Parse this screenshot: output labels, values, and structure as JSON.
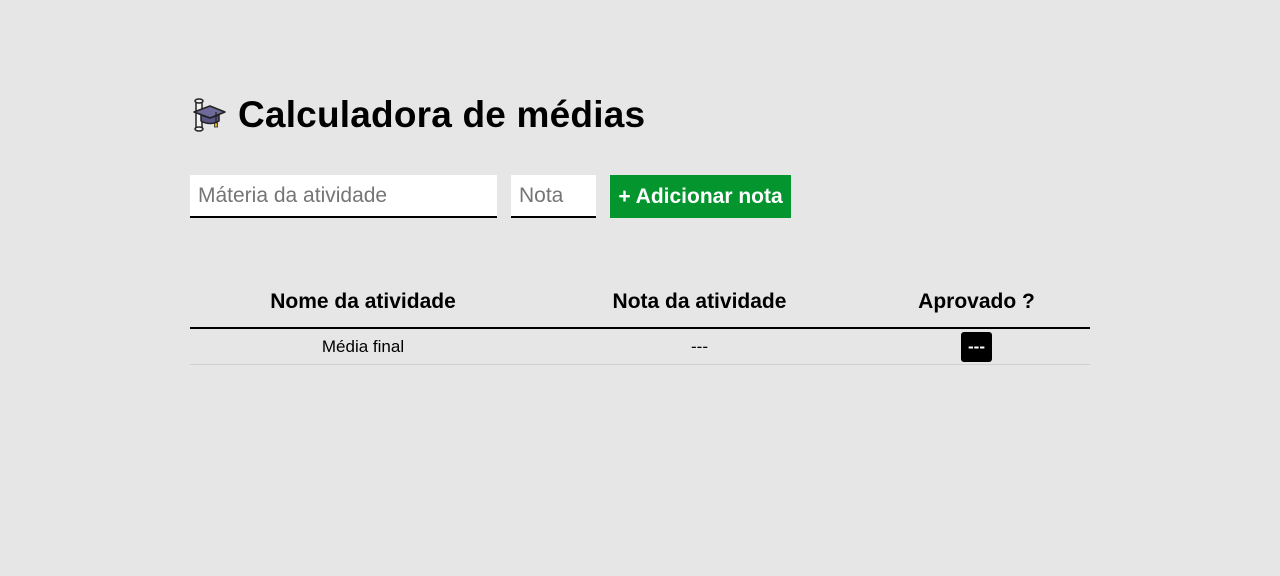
{
  "header": {
    "icon": "graduation-cap-icon",
    "title": "Calculadora de médias"
  },
  "form": {
    "materia_placeholder": "Máteria da atividade",
    "materia_value": "",
    "nota_placeholder": "Nota",
    "nota_value": "",
    "add_button_label": "+ Adicionar nota",
    "add_button_color": "#05952f"
  },
  "table": {
    "columns": [
      "Nome da atividade",
      "Nota da atividade",
      "Aprovado ?"
    ],
    "footer_row": {
      "name": "Média final",
      "grade": "---",
      "status": "---"
    }
  },
  "colors": {
    "background": "#e6e6e6",
    "accent": "#05952f",
    "badge": "#000000"
  }
}
